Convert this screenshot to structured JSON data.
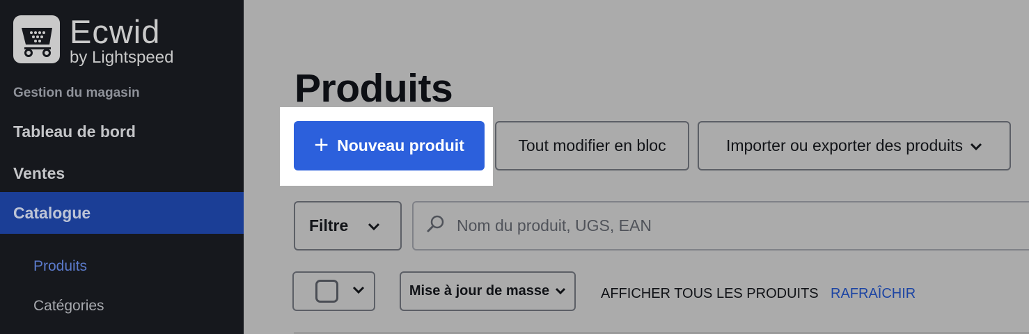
{
  "brand": {
    "name": "Ecwid",
    "tagline": "by Lightspeed"
  },
  "sidebar": {
    "section_label": "Gestion du magasin",
    "items": [
      {
        "label": "Tableau de bord",
        "active": false
      },
      {
        "label": "Ventes",
        "active": false
      },
      {
        "label": "Catalogue",
        "active": true
      }
    ],
    "subitems": [
      {
        "label": "Produits",
        "active": true
      },
      {
        "label": "Catégories",
        "active": false
      }
    ]
  },
  "main": {
    "title": "Produits",
    "toolbar": {
      "new_product_label": "Nouveau produit",
      "bulk_edit_label": "Tout modifier en bloc",
      "import_export_label": "Importer ou exporter des produits"
    },
    "filter_label": "Filtre",
    "search": {
      "placeholder": "Nom du produit, UGS, EAN"
    },
    "bulk_update_label": "Mise à jour de masse",
    "show_all_label": "AFFICHER TOUS LES PRODUITS",
    "refresh_label": "RAFRAÎCHIR"
  },
  "colors": {
    "sidebar_bg": "#16181d",
    "active_nav_bg": "#1b3e96",
    "primary_button": "#2c60dc",
    "overlay_bg": "#ababab",
    "link": "#1d45a3"
  }
}
